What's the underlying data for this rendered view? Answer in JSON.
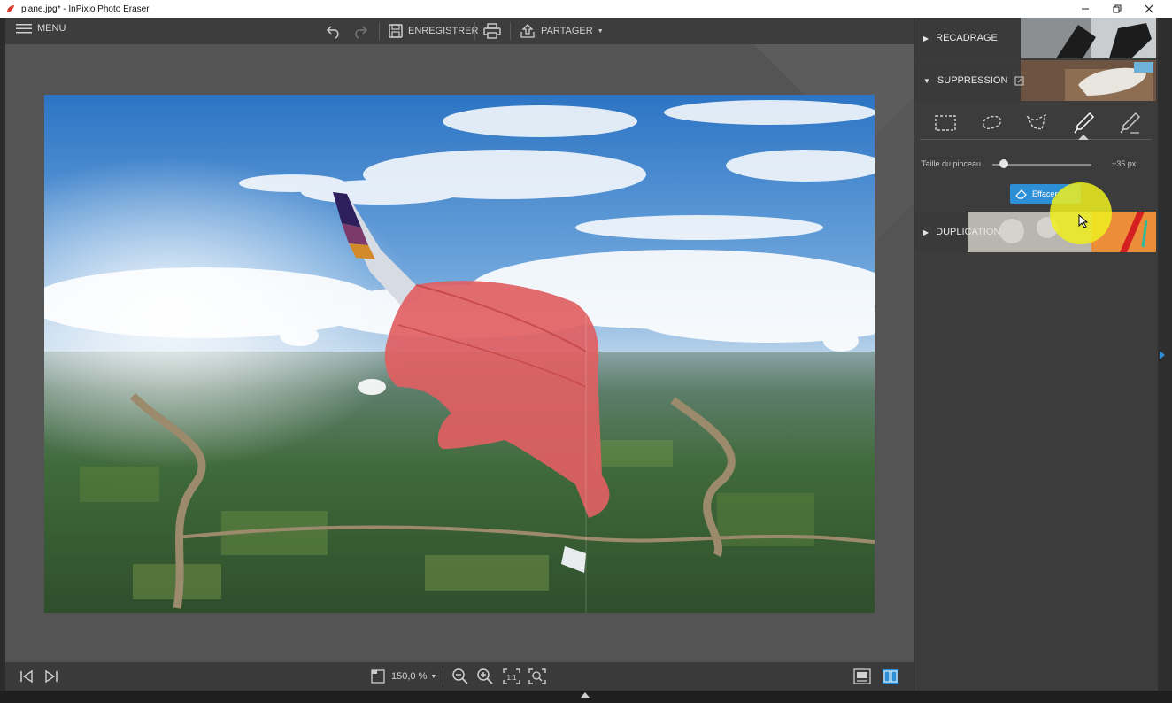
{
  "window": {
    "title": "plane.jpg* - InPixio Photo Eraser",
    "minimize_icon": "minimize-icon",
    "restore_icon": "restore-icon",
    "close_icon": "close-icon"
  },
  "toolbar": {
    "menu_label": "MENU",
    "save_label": "ENREGISTRER",
    "share_label": "PARTAGER"
  },
  "bottom": {
    "zoom": "150,0 %"
  },
  "panel": {
    "crop_label": "RECADRAGE",
    "remove_label": "SUPPRESSION",
    "duplicate_label": "DUPLICATION",
    "tools": [
      "rectangle-select-icon",
      "lasso-icon",
      "polygon-lasso-icon",
      "brush-icon",
      "eraser-brush-icon"
    ],
    "brush_size_label": "Taille du pinceau",
    "brush_size_value": "+35 px",
    "brush_size_fraction": 0.12,
    "erase_label": "Effacer"
  },
  "colors": {
    "accent": "#2d8fd6",
    "mask": "#e06062",
    "highlight": "#eeee1e"
  }
}
